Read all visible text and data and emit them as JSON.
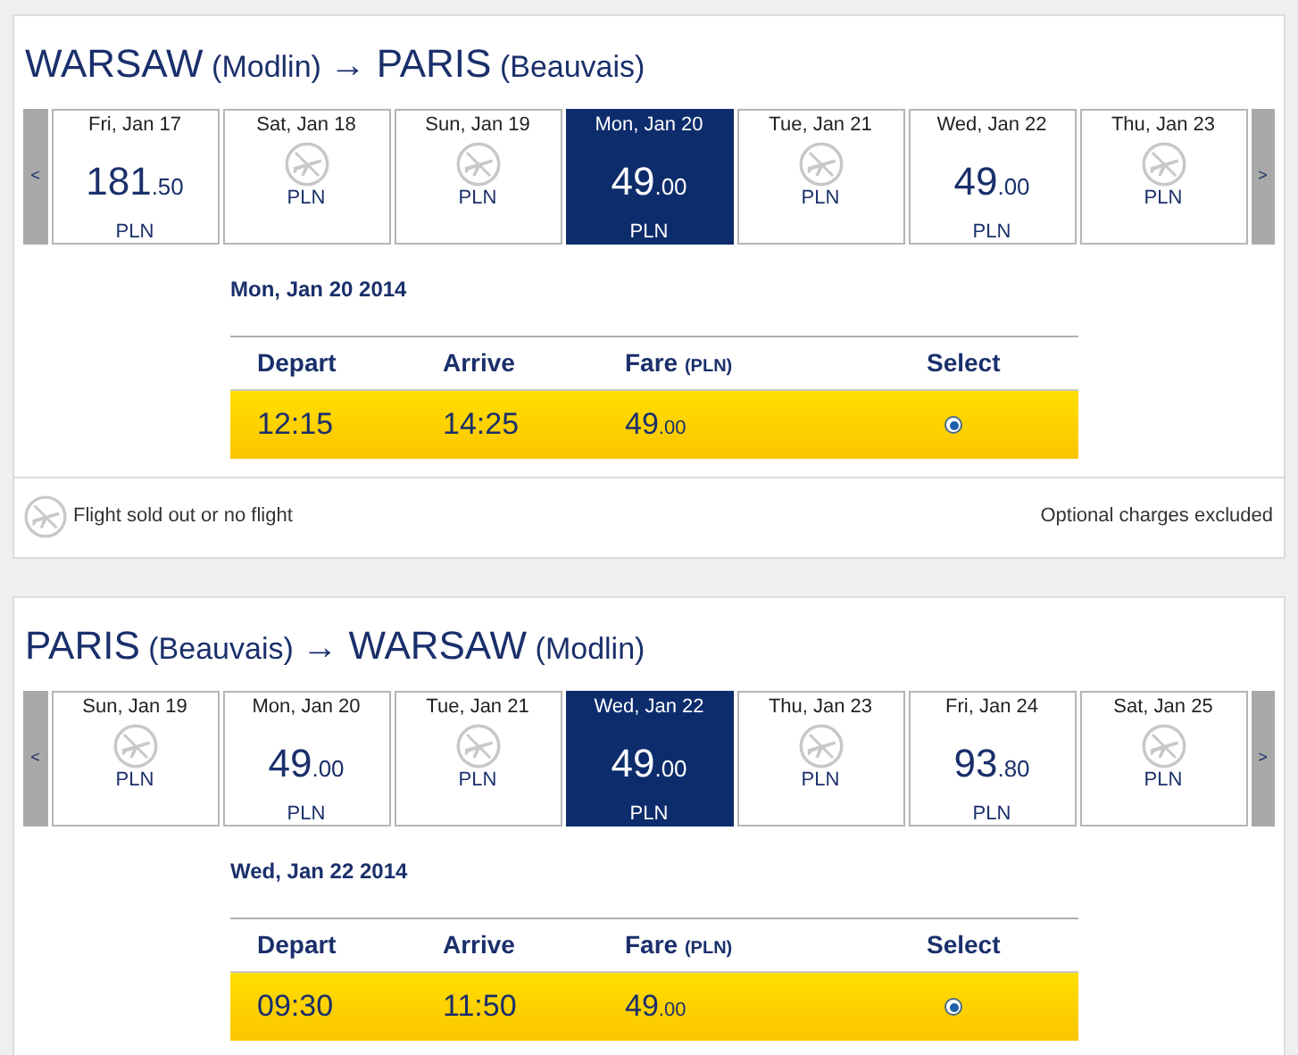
{
  "legs": [
    {
      "origin": "WARSAW",
      "origin_airport": "(Modlin)",
      "arrow": "→",
      "destination": "PARIS",
      "destination_airport": "(Beauvais)",
      "prev": "<",
      "next": ">",
      "days": [
        {
          "date": "Fri, Jan 17",
          "kind": "fare",
          "price": "181",
          "cents": ".50",
          "currency": "PLN",
          "selected": false
        },
        {
          "date": "Sat, Jan 18",
          "kind": "soldout",
          "currency": "PLN",
          "selected": false
        },
        {
          "date": "Sun, Jan 19",
          "kind": "soldout",
          "currency": "PLN",
          "selected": false
        },
        {
          "date": "Mon, Jan 20",
          "kind": "fare",
          "price": "49",
          "cents": ".00",
          "currency": "PLN",
          "selected": true
        },
        {
          "date": "Tue, Jan 21",
          "kind": "soldout",
          "currency": "PLN",
          "selected": false
        },
        {
          "date": "Wed, Jan 22",
          "kind": "fare",
          "price": "49",
          "cents": ".00",
          "currency": "PLN",
          "selected": false
        },
        {
          "date": "Thu, Jan 23",
          "kind": "soldout",
          "currency": "PLN",
          "selected": false
        }
      ],
      "selected_date": "Mon, Jan 20 2014",
      "columns": {
        "depart": "Depart",
        "arrive": "Arrive",
        "fare": "Fare",
        "fare_unit": "(PLN)",
        "select": "Select"
      },
      "flights": [
        {
          "depart": "12:15",
          "arrive": "14:25",
          "price": "49",
          "cents": ".00",
          "selected": true
        }
      ],
      "legend": "Flight sold out or no flight",
      "note": "Optional charges excluded"
    },
    {
      "origin": "PARIS",
      "origin_airport": "(Beauvais)",
      "arrow": "→",
      "destination": "WARSAW",
      "destination_airport": "(Modlin)",
      "prev": "<",
      "next": ">",
      "days": [
        {
          "date": "Sun, Jan 19",
          "kind": "soldout",
          "currency": "PLN",
          "selected": false
        },
        {
          "date": "Mon, Jan 20",
          "kind": "fare",
          "price": "49",
          "cents": ".00",
          "currency": "PLN",
          "selected": false
        },
        {
          "date": "Tue, Jan 21",
          "kind": "soldout",
          "currency": "PLN",
          "selected": false
        },
        {
          "date": "Wed, Jan 22",
          "kind": "fare",
          "price": "49",
          "cents": ".00",
          "currency": "PLN",
          "selected": true
        },
        {
          "date": "Thu, Jan 23",
          "kind": "soldout",
          "currency": "PLN",
          "selected": false
        },
        {
          "date": "Fri, Jan 24",
          "kind": "fare",
          "price": "93",
          "cents": ".80",
          "currency": "PLN",
          "selected": false
        },
        {
          "date": "Sat, Jan 25",
          "kind": "soldout",
          "currency": "PLN",
          "selected": false
        }
      ],
      "selected_date": "Wed, Jan 22 2014",
      "columns": {
        "depart": "Depart",
        "arrive": "Arrive",
        "fare": "Fare",
        "fare_unit": "(PLN)",
        "select": "Select"
      },
      "flights": [
        {
          "depart": "09:30",
          "arrive": "11:50",
          "price": "49",
          "cents": ".00",
          "selected": true
        }
      ]
    }
  ]
}
